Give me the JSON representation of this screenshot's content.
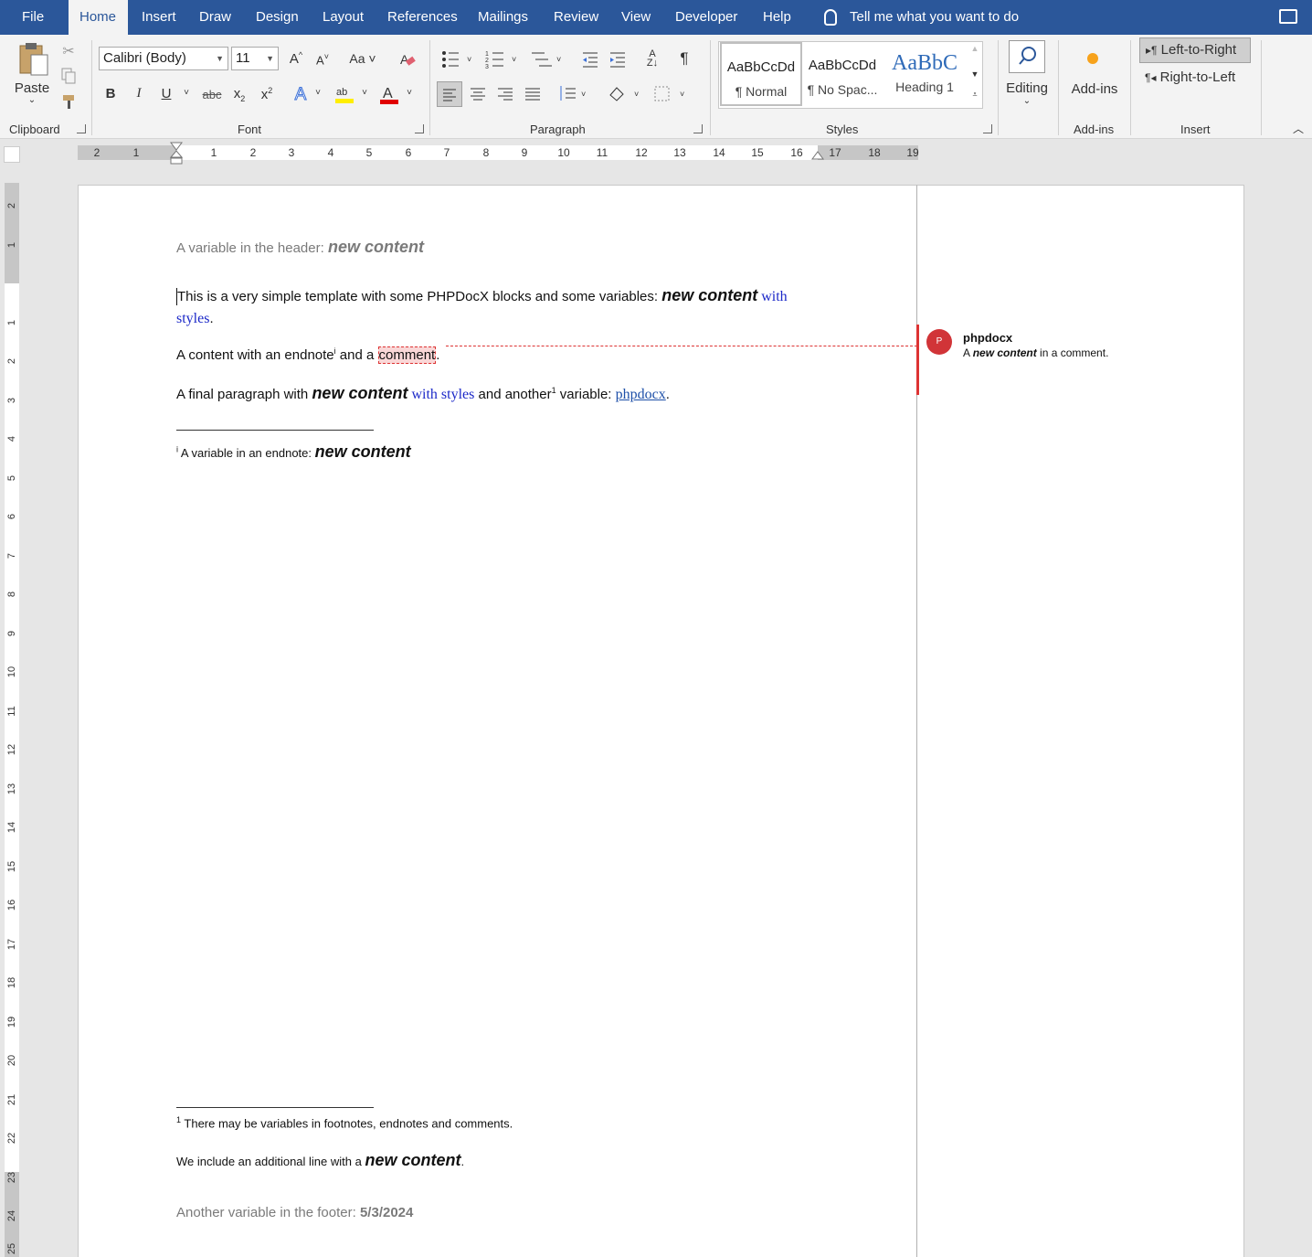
{
  "menu": {
    "items": [
      "File",
      "Home",
      "Insert",
      "Draw",
      "Design",
      "Layout",
      "References",
      "Mailings",
      "Review",
      "View",
      "Developer",
      "Help"
    ],
    "tell_me": "Tell me what you want to do"
  },
  "ribbon": {
    "clipboard": {
      "paste": "Paste",
      "label": "Clipboard"
    },
    "font": {
      "name": "Calibri (Body)",
      "size": "11",
      "label": "Font",
      "case": "Aa"
    },
    "paragraph": {
      "label": "Paragraph"
    },
    "styles": {
      "label": "Styles",
      "items": [
        {
          "preview": "AaBbCcDd",
          "name": "¶ Normal"
        },
        {
          "preview": "AaBbCcDd",
          "name": "¶ No Spac..."
        },
        {
          "preview": "AaBbC",
          "name": "Heading 1"
        }
      ]
    },
    "editing": {
      "label": "Editing"
    },
    "addins": {
      "button": "Add-ins",
      "label": "Add-ins"
    },
    "insert": {
      "ltr": "Left-to-Right",
      "rtl": "Right-to-Left",
      "label": "Insert"
    }
  },
  "ruler": {
    "h_left": [
      "2",
      "1"
    ],
    "h_right": [
      "1",
      "2",
      "3",
      "4",
      "5",
      "6",
      "7",
      "8",
      "9",
      "10",
      "11",
      "12",
      "13",
      "14",
      "15",
      "16",
      "17",
      "18",
      "19"
    ],
    "v_top": [
      "2",
      "1"
    ],
    "v_body": [
      "1",
      "2",
      "3",
      "4",
      "5",
      "6",
      "7",
      "8",
      "9",
      "10",
      "11",
      "12",
      "13",
      "14",
      "15",
      "16",
      "17",
      "18",
      "19",
      "20",
      "21",
      "22",
      "23",
      "24",
      "25"
    ]
  },
  "document": {
    "header_text": "A variable in the header: ",
    "header_var": "new content",
    "p1_text": "This is a very simple template with some PHPDocX blocks and some variables: ",
    "p1_var": "new content",
    "p1_styled_1": " with",
    "p1_styled_2": "styles",
    "p1_end": ".",
    "p2_text": "A content with an endnote",
    "p2_endnote_ref": "i",
    "p2_mid": " and a ",
    "p2_comment": "comment",
    "p2_end": ".",
    "p3_text": "A final paragraph with ",
    "p3_var": "new content",
    "p3_styled": " with styles",
    "p3_mid": " and another",
    "p3_footnote_ref": "1",
    "p3_mid2": " variable: ",
    "p3_link": "phpdocx",
    "p3_end": ".",
    "endnote_ref": "i",
    "endnote_text": " A variable in an endnote: ",
    "endnote_var": "new content",
    "footnote_ref": "1",
    "footnote_text": " There may be variables in footnotes, endnotes and comments.",
    "footnote_line2_text": "We include an additional line with a ",
    "footnote_line2_var": "new content",
    "footnote_line2_end": ".",
    "footer_text": "Another variable in the footer: ",
    "footer_date": "5/3/2024"
  },
  "comment": {
    "avatar": "P",
    "author": "phpdocx",
    "text_a": "A ",
    "text_var": "new content",
    "text_b": " in a comment."
  }
}
